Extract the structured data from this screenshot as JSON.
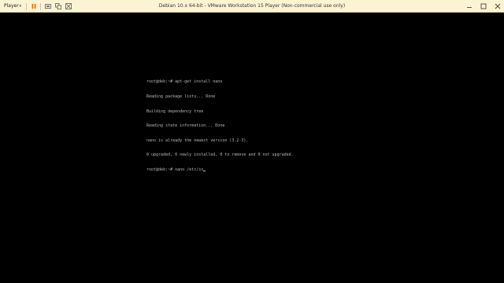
{
  "window": {
    "title": "Debian 10.x 64-bit - VMware Workstation 15 Player (Non-commercial use only)"
  },
  "toolbar": {
    "player_label": "Player",
    "player_chevron": "▾",
    "buttons": [
      {
        "name": "pause-icon"
      },
      {
        "name": "send-ctrl-alt-del-icon"
      },
      {
        "name": "unity-icon"
      },
      {
        "name": "fullscreen-icon"
      }
    ],
    "accent_color": "#e8730c"
  },
  "window_controls": [
    {
      "name": "minimize-icon"
    },
    {
      "name": "maximize-icon"
    },
    {
      "name": "close-icon"
    }
  ],
  "terminal": {
    "lines": [
      "root@deb:~# apt-get install nano",
      "Reading package lists... Done",
      "Building dependency tree",
      "Reading state information... Done",
      "nano is already the newest version (3.2-3).",
      "0 upgraded, 0 newly installed, 0 to remove and 0 not upgraded.",
      "root@deb:~# nano /etc/ss"
    ],
    "text_color": "#b8b8b8",
    "background": "#000000"
  }
}
